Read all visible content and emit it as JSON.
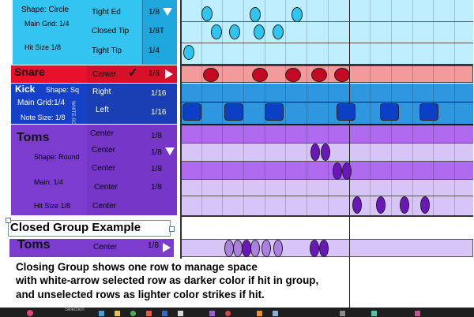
{
  "colors": {
    "hat_panel": "#33c4f2",
    "hat_lane_a": "#bfefff",
    "hat_lane_b": "#9fe6fa",
    "hat_note": "#2ec5ee",
    "snare_panel": "#e8102b",
    "snare_lane": "#f39a9a",
    "snare_note": "#c40a22",
    "kick_panel": "#1441c8",
    "kick_lane": "#2f97e0",
    "kick_note": "#0b3fc6",
    "toms_panel": "#7c3cd0",
    "toms_lane_dark": "#b06af0",
    "toms_lane_light": "#d7c5f7",
    "toms_note_dark": "#6a16b8",
    "toms_note_light": "#ab80de",
    "taskbar": "#1f1f1f"
  },
  "hat": {
    "shape_label": "Shape: Circle",
    "grid_label": "Main Grid: 1/4",
    "hit_label": "Hit Size 1/8",
    "rows": [
      {
        "name": "Tight Ed",
        "value": "1/8"
      },
      {
        "name": "Closed Tip",
        "value": "1/8T"
      },
      {
        "name": "Tight Tip",
        "value": "1/4"
      }
    ]
  },
  "snare": {
    "title": "Snare",
    "row": {
      "name": "Center",
      "value": "1/8"
    },
    "check_glyph": "✓"
  },
  "kick": {
    "title": "Kick",
    "shape_label": "Shape: Sq",
    "grid_label": "Main Grid:1/4",
    "note_label": "Note Size: 1/8",
    "side_text": "WHITE-SOLO",
    "rows": [
      {
        "name": "Right",
        "value": "1/16"
      },
      {
        "name": "Left",
        "value": "1/16"
      }
    ]
  },
  "toms": {
    "title": "Toms",
    "shape_label": "Shape: Round",
    "main_label": "Main: 1/4",
    "hit_label": "Hit Size 1/8",
    "rows": [
      {
        "name": "Center",
        "value": "1/8"
      },
      {
        "name": "Center",
        "value": "1/8"
      },
      {
        "name": "Center",
        "value": "1/8"
      },
      {
        "name": "Center",
        "value": "1/8"
      },
      {
        "name": "Center",
        "value": ""
      }
    ]
  },
  "closed_example": {
    "title": "Closed Group Example",
    "group_title": "Toms",
    "row": {
      "name": "Center",
      "value": "1/8"
    }
  },
  "caption": {
    "line1": "Closing Group shows one row to manage space",
    "line2": "with white-arrow selected row as darker color if hit in group,",
    "line3": "and unselected rows as lighter color strikes if hit."
  },
  "taskbar": {
    "selection_label": "Selection"
  }
}
